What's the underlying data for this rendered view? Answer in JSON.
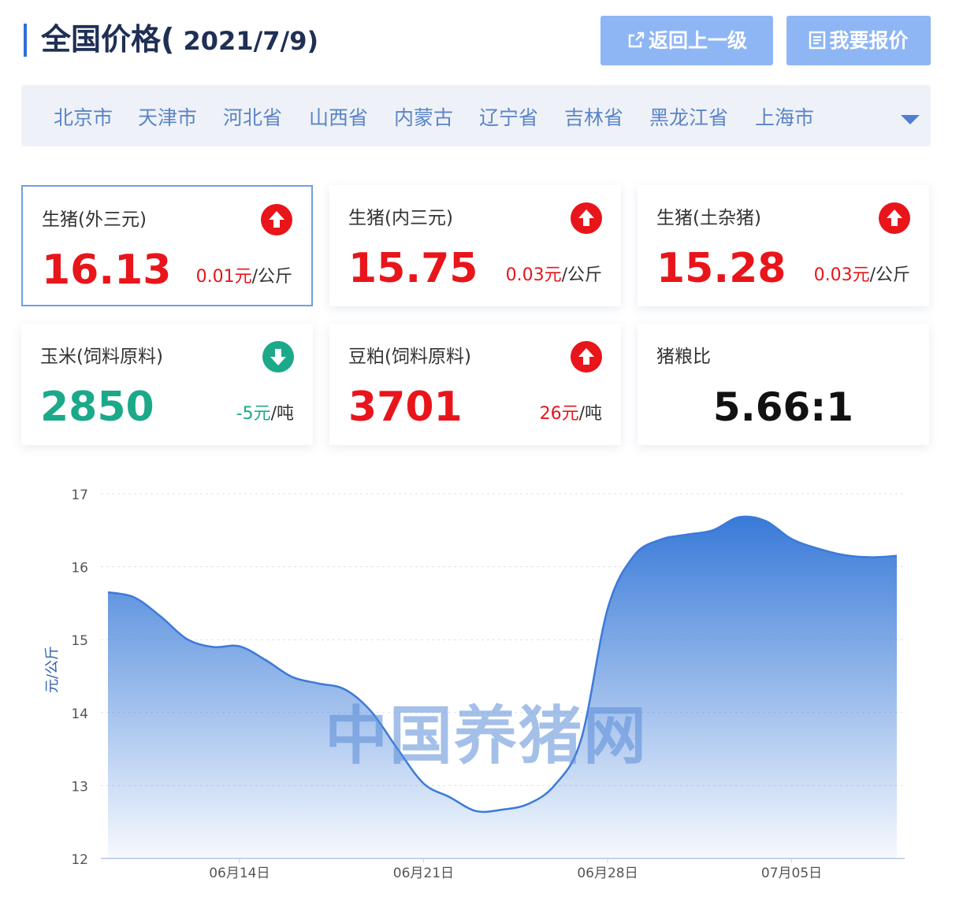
{
  "header": {
    "title": "全国价格(",
    "date": " 2021/7/9)",
    "back_label": "返回上一级",
    "quote_label": "我要报价"
  },
  "regions": [
    "北京市",
    "天津市",
    "河北省",
    "山西省",
    "内蒙古",
    "辽宁省",
    "吉林省",
    "黑龙江省",
    "上海市"
  ],
  "cards": [
    {
      "name": "生猪(外三元)",
      "value": "16.13",
      "change": "0.01元",
      "unit": "/公斤",
      "trend": "up",
      "color": "#e8151b"
    },
    {
      "name": "生猪(内三元)",
      "value": "15.75",
      "change": "0.03元",
      "unit": "/公斤",
      "trend": "up",
      "color": "#e8151b"
    },
    {
      "name": "生猪(土杂猪)",
      "value": "15.28",
      "change": "0.03元",
      "unit": "/公斤",
      "trend": "up",
      "color": "#e8151b"
    },
    {
      "name": "玉米(饲料原料)",
      "value": "2850",
      "change": "-5元",
      "unit": "/吨",
      "trend": "down",
      "color": "#1ba98a"
    },
    {
      "name": "豆粕(饲料原料)",
      "value": "3701",
      "change": "26元",
      "unit": "/吨",
      "trend": "up",
      "color": "#e8151b"
    },
    {
      "name": "猪粮比",
      "value": "5.66:1"
    }
  ],
  "watermark": "中国养猪网",
  "colors": {
    "accent": "#2f6fd6",
    "up": "#e8151b",
    "down": "#1ba98a",
    "button": "#8fb6f4"
  },
  "chart_data": {
    "type": "area",
    "ylabel": "元/公斤",
    "xlabel": "",
    "ylim": [
      12,
      17
    ],
    "yticks": [
      "17",
      "16",
      "15",
      "14",
      "13",
      "12"
    ],
    "xticks": [
      "06月14日",
      "06月21日",
      "06月28日",
      "07月05日"
    ],
    "x": [
      "06月09日",
      "06月10日",
      "06月11日",
      "06月12日",
      "06月13日",
      "06月14日",
      "06月15日",
      "06月16日",
      "06月17日",
      "06月18日",
      "06月19日",
      "06月20日",
      "06月21日",
      "06月22日",
      "06月23日",
      "06月24日",
      "06月25日",
      "06月26日",
      "06月27日",
      "06月28日",
      "06月29日",
      "06月30日",
      "07月01日",
      "07月02日",
      "07月03日",
      "07月04日",
      "07月05日",
      "07月06日",
      "07月07日",
      "07月08日",
      "07月09日"
    ],
    "series": [
      {
        "values": [
          15.65,
          15.58,
          15.32,
          15.01,
          14.9,
          14.91,
          14.72,
          14.49,
          14.4,
          14.32,
          14.02,
          13.51,
          13.03,
          12.84,
          12.65,
          12.67,
          12.75,
          13.01,
          13.64,
          15.42,
          16.15,
          16.37,
          16.44,
          16.5,
          16.68,
          16.63,
          16.38,
          16.25,
          16.16,
          16.13,
          16.15
        ]
      }
    ],
    "grid": true,
    "line_color": "#3b7ad8"
  }
}
